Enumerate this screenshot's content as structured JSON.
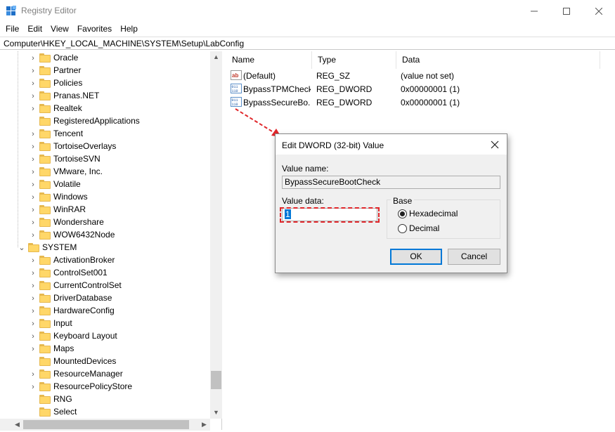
{
  "window": {
    "title": "Registry Editor",
    "minimize_icon": "minimize-icon",
    "maximize_icon": "maximize-icon",
    "close_icon": "close-icon"
  },
  "menu": [
    "File",
    "Edit",
    "View",
    "Favorites",
    "Help"
  ],
  "address": "Computer\\HKEY_LOCAL_MACHINE\\SYSTEM\\Setup\\LabConfig",
  "tree": {
    "items": [
      {
        "label": "Oracle",
        "level": 2,
        "expanded": false
      },
      {
        "label": "Partner",
        "level": 2,
        "expanded": false
      },
      {
        "label": "Policies",
        "level": 2,
        "expanded": false
      },
      {
        "label": "Pranas.NET",
        "level": 2,
        "expanded": false
      },
      {
        "label": "Realtek",
        "level": 2,
        "expanded": false
      },
      {
        "label": "RegisteredApplications",
        "level": 2,
        "expanded": false,
        "no_chevron": true
      },
      {
        "label": "Tencent",
        "level": 2,
        "expanded": false
      },
      {
        "label": "TortoiseOverlays",
        "level": 2,
        "expanded": false
      },
      {
        "label": "TortoiseSVN",
        "level": 2,
        "expanded": false
      },
      {
        "label": "VMware, Inc.",
        "level": 2,
        "expanded": false
      },
      {
        "label": "Volatile",
        "level": 2,
        "expanded": false
      },
      {
        "label": "Windows",
        "level": 2,
        "expanded": false
      },
      {
        "label": "WinRAR",
        "level": 2,
        "expanded": false
      },
      {
        "label": "Wondershare",
        "level": 2,
        "expanded": false
      },
      {
        "label": "WOW6432Node",
        "level": 2,
        "expanded": false
      },
      {
        "label": "SYSTEM",
        "level": 1,
        "expanded": true
      },
      {
        "label": "ActivationBroker",
        "level": 2,
        "expanded": false
      },
      {
        "label": "ControlSet001",
        "level": 2,
        "expanded": false
      },
      {
        "label": "CurrentControlSet",
        "level": 2,
        "expanded": false
      },
      {
        "label": "DriverDatabase",
        "level": 2,
        "expanded": false
      },
      {
        "label": "HardwareConfig",
        "level": 2,
        "expanded": false
      },
      {
        "label": "Input",
        "level": 2,
        "expanded": false
      },
      {
        "label": "Keyboard Layout",
        "level": 2,
        "expanded": false
      },
      {
        "label": "Maps",
        "level": 2,
        "expanded": false
      },
      {
        "label": "MountedDevices",
        "level": 2,
        "expanded": false,
        "no_chevron": true
      },
      {
        "label": "ResourceManager",
        "level": 2,
        "expanded": false
      },
      {
        "label": "ResourcePolicyStore",
        "level": 2,
        "expanded": false
      },
      {
        "label": "RNG",
        "level": 2,
        "expanded": false,
        "no_chevron": true
      },
      {
        "label": "Select",
        "level": 2,
        "expanded": false,
        "no_chevron": true
      }
    ]
  },
  "list": {
    "columns": [
      "Name",
      "Type",
      "Data"
    ],
    "rows": [
      {
        "name": "(Default)",
        "type": "REG_SZ",
        "data": "(value not set)",
        "icon": "string-value-icon"
      },
      {
        "name": "BypassTPMCheck",
        "type": "REG_DWORD",
        "data": "0x00000001 (1)",
        "icon": "binary-value-icon"
      },
      {
        "name": "BypassSecureBo...",
        "type": "REG_DWORD",
        "data": "0x00000001 (1)",
        "icon": "binary-value-icon"
      }
    ]
  },
  "dialog": {
    "title": "Edit DWORD (32-bit) Value",
    "value_name_label": "Value name:",
    "value_name": "BypassSecureBootCheck",
    "value_data_label": "Value data:",
    "value_data": "1",
    "base_label": "Base",
    "base_options": [
      {
        "label": "Hexadecimal",
        "selected": true
      },
      {
        "label": "Decimal",
        "selected": false
      }
    ],
    "ok_label": "OK",
    "cancel_label": "Cancel"
  },
  "colors": {
    "annotation_red": "#e0262a",
    "folder_yellow": "#ffd768",
    "selection_blue": "#0078d7"
  }
}
